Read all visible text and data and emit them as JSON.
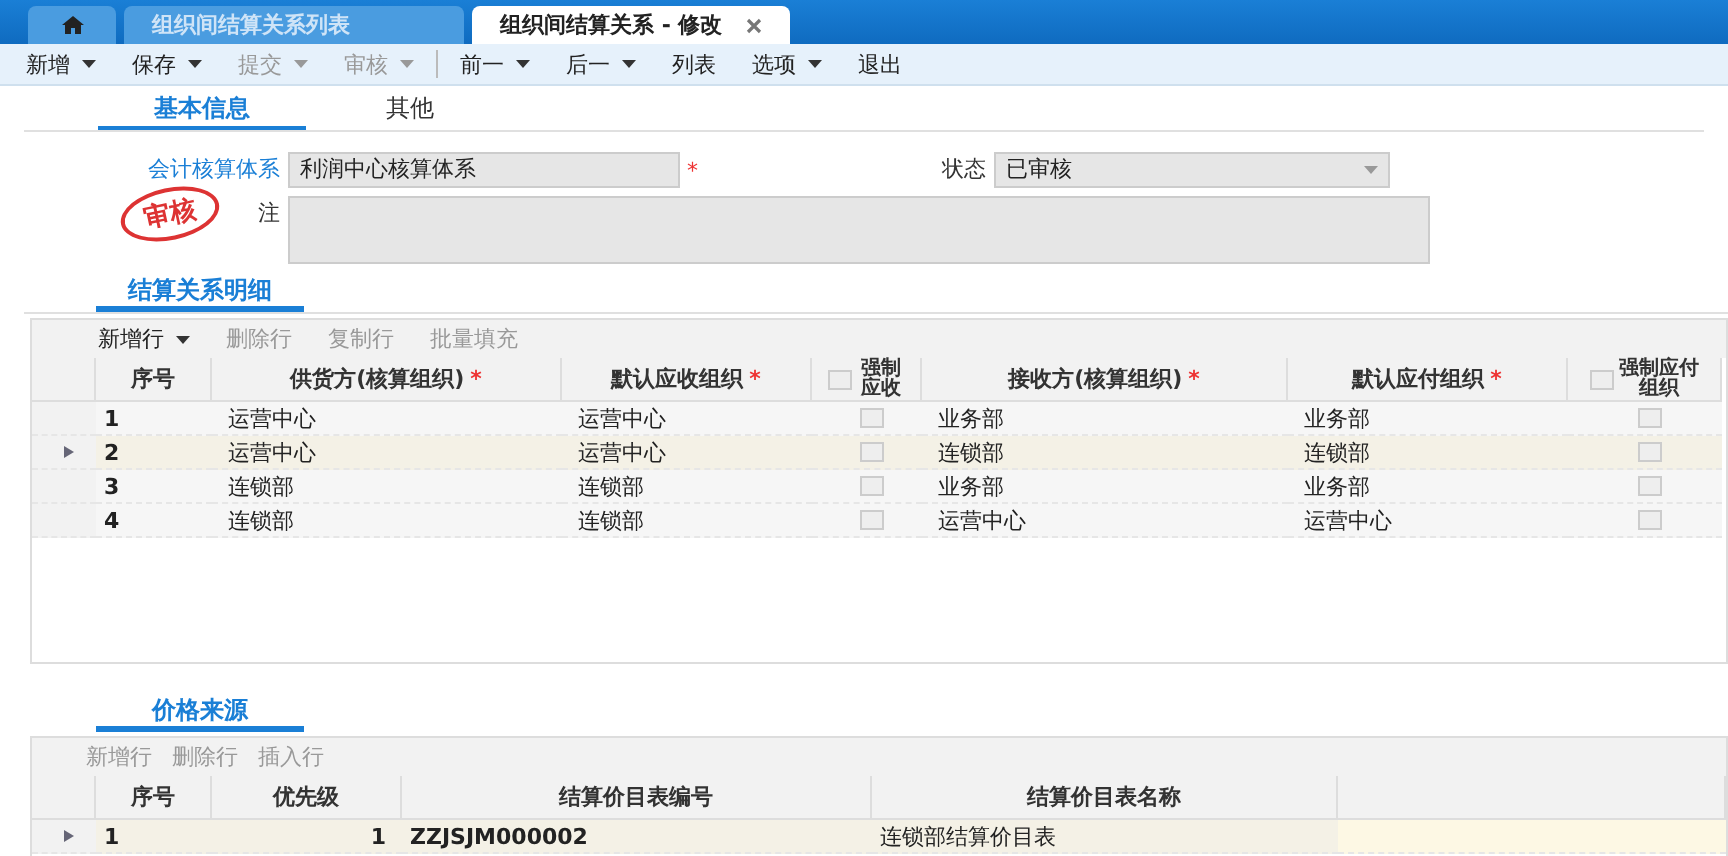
{
  "window_tabs": [
    {
      "kind": "home",
      "selected": false
    },
    {
      "kind": "text",
      "label": "组织间结算关系列表",
      "selected": false,
      "closable": false
    },
    {
      "kind": "text",
      "label": "组织间结算关系 - 修改",
      "selected": true,
      "closable": true
    }
  ],
  "toolbar": [
    {
      "label": "新增",
      "dropdown": true,
      "disabled": false
    },
    {
      "label": "保存",
      "dropdown": true,
      "disabled": false
    },
    {
      "label": "提交",
      "dropdown": true,
      "disabled": true
    },
    {
      "label": "审核",
      "dropdown": true,
      "disabled": true
    },
    {
      "label": "前一",
      "dropdown": true,
      "disabled": false
    },
    {
      "label": "后一",
      "dropdown": true,
      "disabled": false
    },
    {
      "label": "列表",
      "dropdown": false,
      "disabled": false
    },
    {
      "label": "选项",
      "dropdown": true,
      "disabled": false
    },
    {
      "label": "退出",
      "dropdown": false,
      "disabled": false
    }
  ],
  "form_tabs": [
    {
      "label": "基本信息",
      "selected": true
    },
    {
      "label": "其他",
      "selected": false
    }
  ],
  "form": {
    "accounting_system": {
      "label": "会计核算体系",
      "value": "利润中心核算体系",
      "required_mark": "*"
    },
    "status": {
      "label": "状态",
      "value": "已审核"
    },
    "remark": {
      "label": "注"
    },
    "stamp": "审核"
  },
  "detail": {
    "title": "结算关系明细",
    "actions": [
      {
        "label": "新增行",
        "dropdown": true,
        "disabled": false
      },
      {
        "label": "删除行",
        "dropdown": false,
        "disabled": true
      },
      {
        "label": "复制行",
        "dropdown": false,
        "disabled": true
      },
      {
        "label": "批量填充",
        "dropdown": false,
        "disabled": true
      }
    ],
    "columns": [
      {
        "label": "序号",
        "kind": "text"
      },
      {
        "label": "供货方(核算组织)",
        "kind": "text",
        "required_mark": "*"
      },
      {
        "label": "默认应收组织",
        "kind": "text",
        "required_mark": "*"
      },
      {
        "label": "强制应收",
        "kind": "check",
        "checked": false
      },
      {
        "label": "接收方(核算组织)",
        "kind": "text",
        "required_mark": "*"
      },
      {
        "label": "默认应付组织",
        "kind": "text",
        "required_mark": "*"
      },
      {
        "label": "强制应付组织",
        "kind": "check",
        "checked": false
      }
    ],
    "rows": [
      {
        "selected": false,
        "cells": [
          "1",
          "运营中心",
          "运营中心",
          false,
          "业务部",
          "业务部",
          false
        ]
      },
      {
        "selected": true,
        "cells": [
          "2",
          "运营中心",
          "运营中心",
          false,
          "连锁部",
          "连锁部",
          false
        ]
      },
      {
        "selected": false,
        "cells": [
          "3",
          "连锁部",
          "连锁部",
          false,
          "业务部",
          "业务部",
          false
        ]
      },
      {
        "selected": false,
        "cells": [
          "4",
          "连锁部",
          "连锁部",
          false,
          "运营中心",
          "运营中心",
          false
        ]
      }
    ]
  },
  "price_source": {
    "title": "价格来源",
    "actions": [
      {
        "label": "新增行",
        "disabled": true
      },
      {
        "label": "删除行",
        "disabled": true
      },
      {
        "label": "插入行",
        "disabled": true
      }
    ],
    "columns": [
      "序号",
      "优先级",
      "结算价目表编号",
      "结算价目表名称"
    ],
    "rows": [
      {
        "selected": true,
        "cells": [
          "1",
          "1",
          "ZZJSJM000002",
          "连锁部结算价目表"
        ]
      }
    ]
  }
}
